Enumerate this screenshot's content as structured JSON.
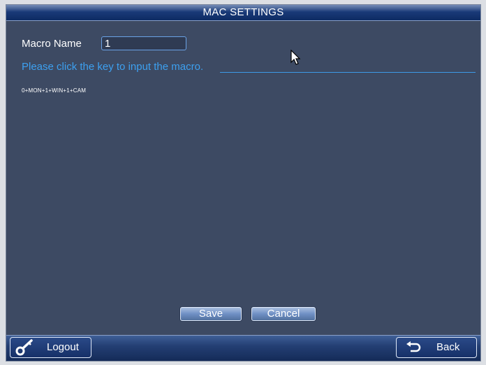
{
  "window": {
    "title": "MAC SETTINGS"
  },
  "form": {
    "macro_name_label": "Macro Name",
    "macro_name_value": "1",
    "hint": "Please click the key to input the macro.",
    "macro_sequence": "0+MON+1+WIN+1+CAM"
  },
  "buttons": {
    "save": "Save",
    "cancel": "Cancel"
  },
  "footer": {
    "logout": "Logout",
    "back": "Back"
  },
  "icons": {
    "logout": "key-icon",
    "back": "return-arrow-icon",
    "cursor": "mouse-pointer-icon"
  },
  "colors": {
    "panel_bg": "#3d4a63",
    "hint_text": "#3da0f0",
    "title_bar": "#1a3a78"
  }
}
